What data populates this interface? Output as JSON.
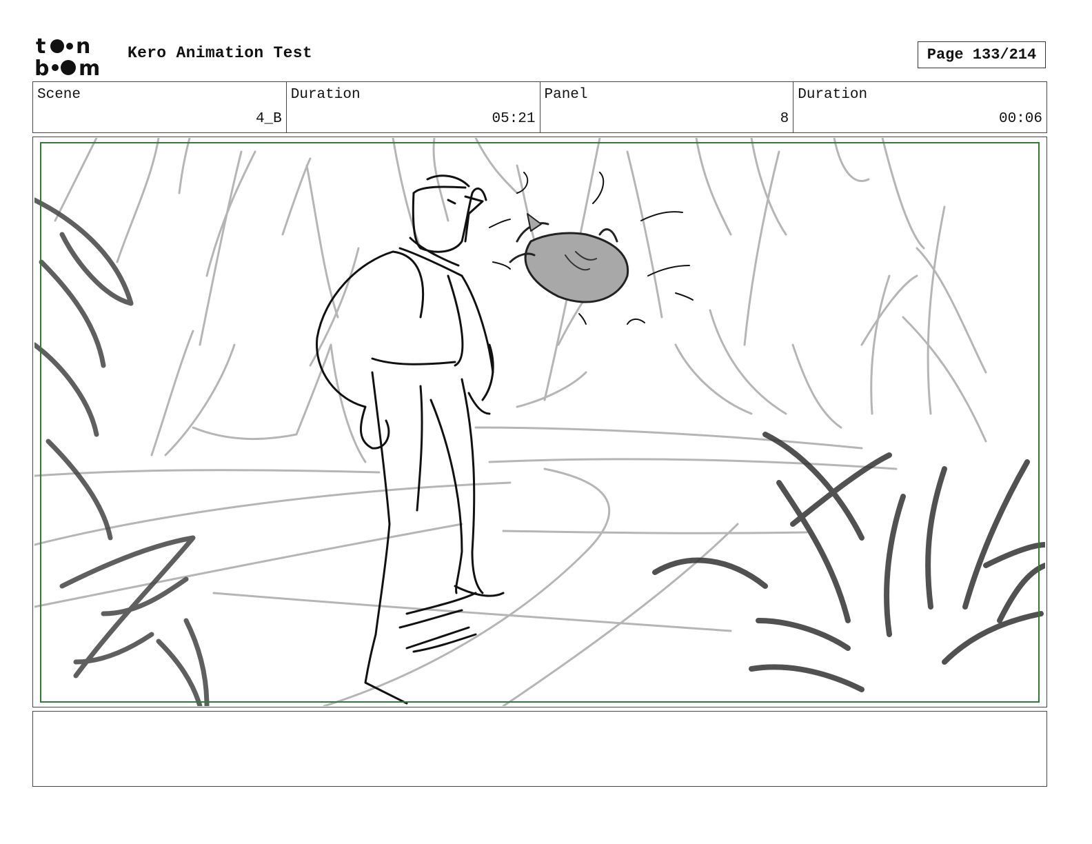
{
  "header": {
    "logo_text": "toon boom",
    "project_title": "Kero Animation Test",
    "page_label": "Page 133/214"
  },
  "info": {
    "scene_label": "Scene",
    "scene_value": "4_B",
    "scene_duration_label": "Duration",
    "scene_duration_value": "05:21",
    "panel_label": "Panel",
    "panel_value": "8",
    "panel_duration_label": "Duration",
    "panel_duration_value": "00:06"
  },
  "panel": {
    "frame_color": "#2e7d32",
    "image_subject": "storyboard-sketch"
  },
  "notes": {
    "text": ""
  }
}
